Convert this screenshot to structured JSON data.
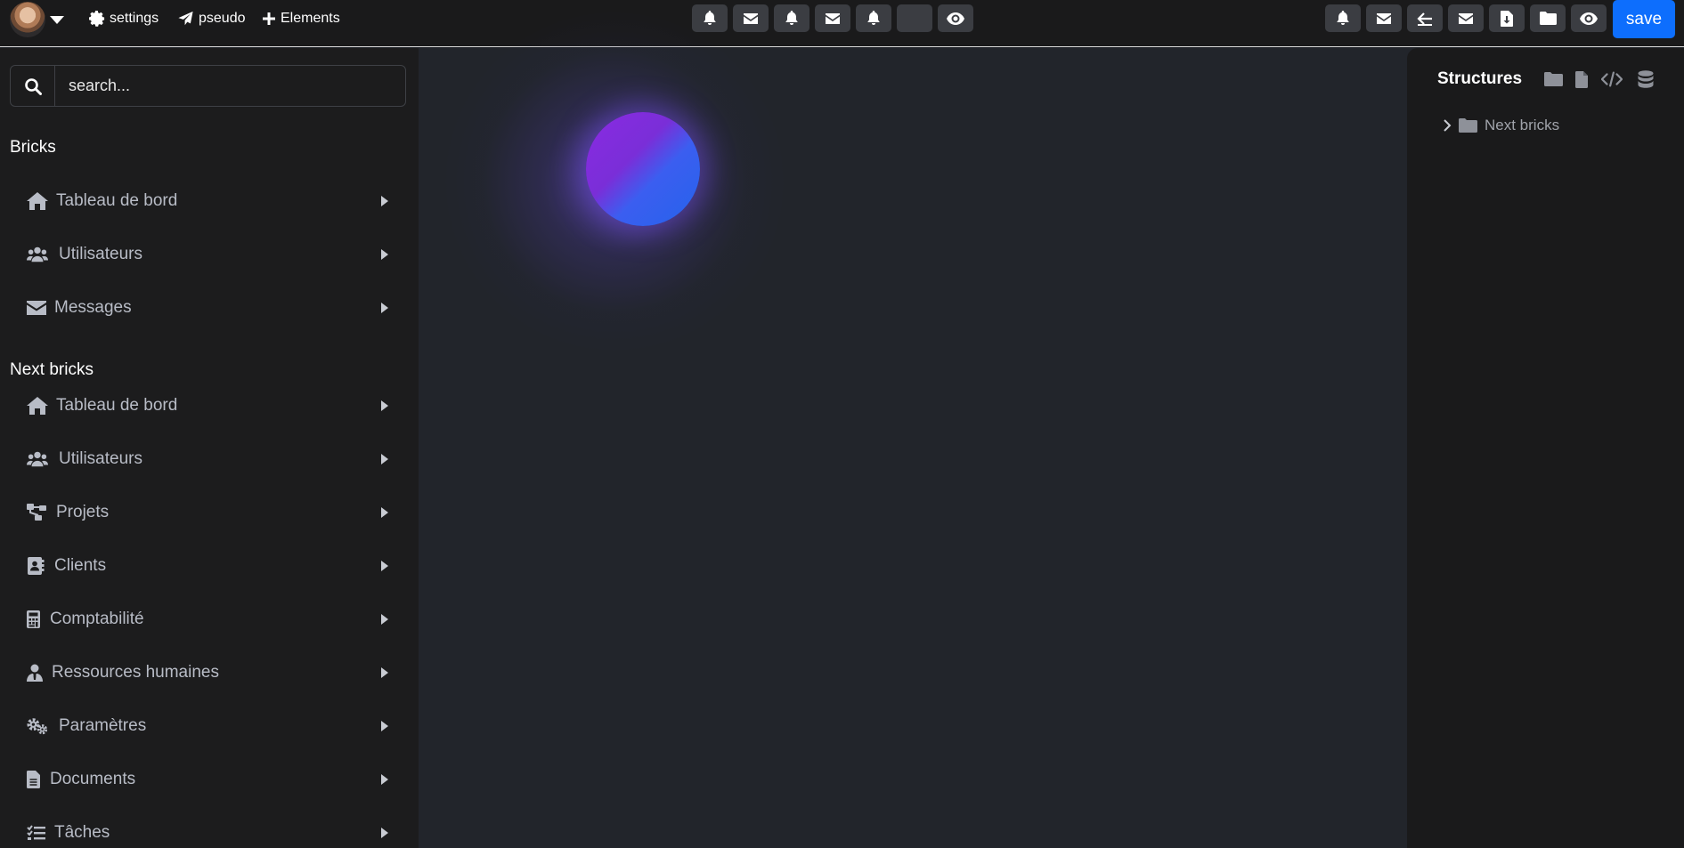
{
  "topbar": {
    "links": [
      {
        "label": "settings",
        "icon": "gear-icon"
      },
      {
        "label": "pseudo",
        "icon": "paper-plane-icon"
      },
      {
        "label": "Elements",
        "icon": "plus-icon"
      }
    ],
    "center_buttons": [
      "bell-icon",
      "envelope-icon",
      "bell-icon",
      "envelope-icon",
      "bell-icon",
      "blank",
      "eye-icon"
    ],
    "right_buttons": [
      "bell-icon",
      "envelope-icon",
      "arrow-left-icon",
      "envelope-icon",
      "file-download-icon",
      "folder-icon",
      "eye-icon"
    ],
    "save_label": "save"
  },
  "search": {
    "placeholder": "search..."
  },
  "sidebar": {
    "section1": {
      "title": "Bricks",
      "items": [
        {
          "label": "Tableau de bord",
          "icon": "home-icon"
        },
        {
          "label": "Utilisateurs",
          "icon": "users-icon"
        },
        {
          "label": "Messages",
          "icon": "envelope-icon"
        }
      ]
    },
    "section2": {
      "title": "Next bricks",
      "items": [
        {
          "label": "Tableau de bord",
          "icon": "home-icon"
        },
        {
          "label": "Utilisateurs",
          "icon": "users-icon"
        },
        {
          "label": "Projets",
          "icon": "sitemap-icon"
        },
        {
          "label": "Clients",
          "icon": "address-book-icon"
        },
        {
          "label": "Comptabilité",
          "icon": "calculator-icon"
        },
        {
          "label": "Ressources humaines",
          "icon": "user-tie-icon"
        },
        {
          "label": "Paramètres",
          "icon": "cogs-icon"
        },
        {
          "label": "Documents",
          "icon": "file-icon"
        },
        {
          "label": "Tâches",
          "icon": "tasks-icon"
        }
      ]
    }
  },
  "structures": {
    "title": "Structures",
    "toolbar_icons": [
      "folder-icon",
      "file-icon",
      "code-icon",
      "database-icon"
    ],
    "tree": [
      {
        "label": "Next bricks",
        "icon": "folder-icon",
        "expanded": false
      }
    ]
  },
  "colors": {
    "accent": "#0d6efd",
    "orb_start": "#8a2be2",
    "orb_end": "#2563eb"
  }
}
